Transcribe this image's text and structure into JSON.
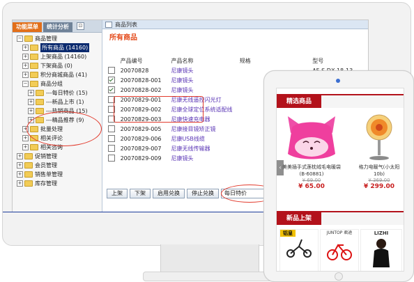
{
  "admin": {
    "tabs": [
      "功能菜单",
      "统计分析"
    ],
    "tab_close": "⊡",
    "tree": [
      {
        "exp": "−",
        "label": "商品管理"
      },
      {
        "exp": "+",
        "label": "所有商品 (14160)",
        "selected": true
      },
      {
        "exp": "+",
        "label": "上架商品 (14160)"
      },
      {
        "exp": "+",
        "label": "下架商品 (0)"
      },
      {
        "exp": "+",
        "label": "积分商城商品 (41)"
      },
      {
        "exp": "−",
        "label": "商品分组"
      },
      {
        "exp": "+",
        "label": "---每日特价 (15)"
      },
      {
        "exp": "+",
        "label": "---新品上市 (1)"
      },
      {
        "exp": "+",
        "label": "---热销商品 (15)"
      },
      {
        "exp": "+",
        "label": "---精品推荐 (9)"
      },
      {
        "exp": "+",
        "label": "批量处理"
      },
      {
        "exp": "+",
        "label": "相关评论"
      },
      {
        "exp": "+",
        "label": "相关咨询"
      },
      {
        "exp": "+",
        "label": "促销管理"
      },
      {
        "exp": "+",
        "label": "会员管理"
      },
      {
        "exp": "+",
        "label": "销售单管理"
      },
      {
        "exp": "+",
        "label": "库存管理"
      }
    ],
    "right_bar_title": "商品列表",
    "heading": "所有商品",
    "columns": [
      "产品编号",
      "产品名称",
      "规格",
      "型号"
    ],
    "rows": [
      {
        "checked": false,
        "code": "20070828",
        "name": "尼康镜头",
        "spec": "",
        "model": "AF-S DX 18-13"
      },
      {
        "checked": true,
        "code": "20070828-001",
        "name": "尼康镜头",
        "spec": "",
        "model": ""
      },
      {
        "checked": true,
        "code": "20070828-002",
        "name": "尼康镜头",
        "spec": "",
        "model": ""
      },
      {
        "checked": false,
        "code": "20070829-001",
        "name": "尼康无线遥控闪光灯",
        "spec": "",
        "model": ""
      },
      {
        "checked": false,
        "code": "20070829-002",
        "name": "尼康全球定位系统适配线",
        "spec": "",
        "model": ""
      },
      {
        "checked": false,
        "code": "20070829-003",
        "name": "尼康快速充电器",
        "spec": "",
        "model": ""
      },
      {
        "checked": false,
        "code": "20070829-005",
        "name": "尼康接目镜矫正镜",
        "spec": "",
        "model": ""
      },
      {
        "checked": false,
        "code": "20070829-006",
        "name": "尼康USB线缆",
        "spec": "",
        "model": ""
      },
      {
        "checked": false,
        "code": "20070829-007",
        "name": "尼康无线传输器",
        "spec": "",
        "model": ""
      },
      {
        "checked": false,
        "code": "20070829-009",
        "name": "尼康镜头",
        "spec": "",
        "model": ""
      }
    ],
    "buttons": [
      "上架",
      "下架",
      "启用兑换",
      "停止兑换"
    ],
    "group_select": "每日特价"
  },
  "tablet": {
    "section1": "精选商品",
    "section2": "新品上架",
    "products": [
      {
        "name": "美美插手式莲枕绒毛电暖袋",
        "sub": "(B-60881)",
        "old_price": "¥ 69.00",
        "price": "¥ 65.00"
      },
      {
        "name": "格力电暖气(小太阳",
        "sub": "10b)",
        "old_price": "¥ 369.00",
        "price": "¥ 299.00"
      }
    ],
    "brand_labels": [
      "铝皇",
      "JUNTOP 君途",
      "LIZHI"
    ],
    "arrow": "‹"
  },
  "colors": {
    "accent_red": "#b3121b",
    "selected_bg": "#0b2a6e",
    "orange_tab": "#e26f1a",
    "oval": "#e23a2c"
  }
}
